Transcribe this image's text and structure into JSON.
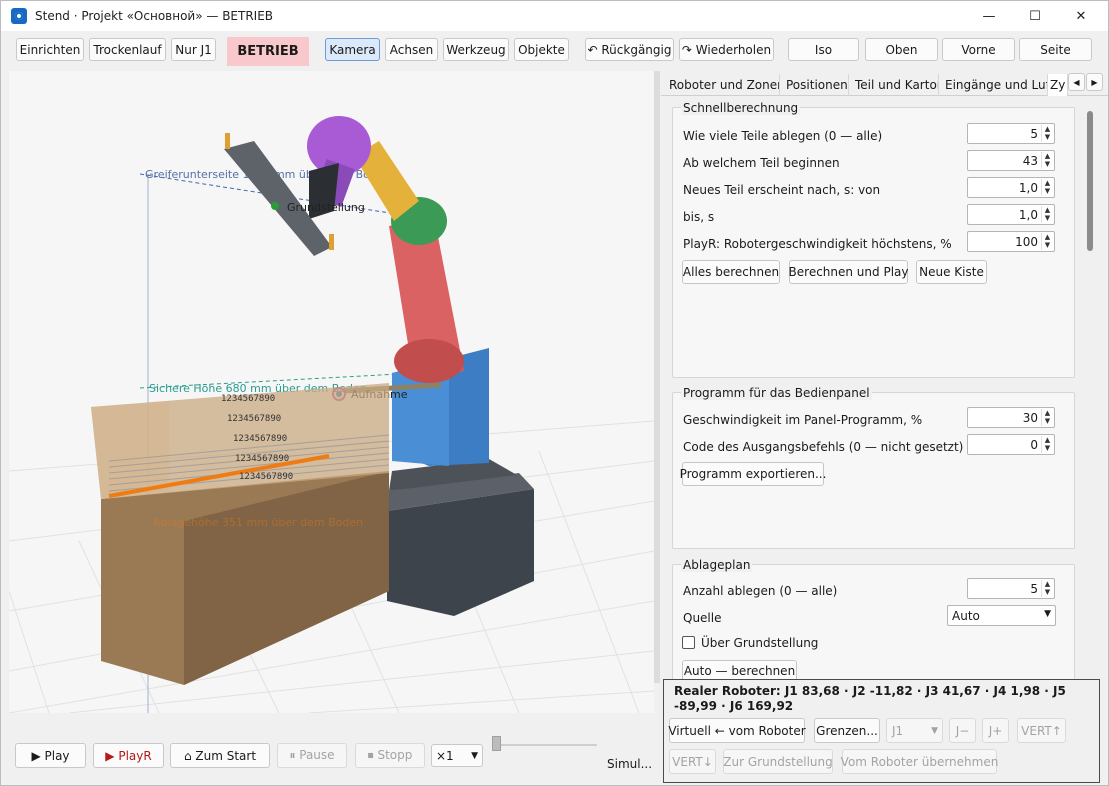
{
  "window": {
    "title": "Stend · Projekt «Основной» — BETRIEB",
    "min": "—",
    "max": "☐",
    "close": "✕"
  },
  "toolbar": {
    "mode_buttons": [
      "Einrichten",
      "Trockenlauf",
      "Nur J1"
    ],
    "mode_badge": "BETRIEB",
    "view_tabs": [
      "Kamera",
      "Achsen",
      "Werkzeug",
      "Objekte"
    ],
    "undo": "↶ Rückgängig",
    "redo": "↷ Wiederholen",
    "camera_views": [
      "Iso",
      "Oben",
      "Vorne",
      "Seite"
    ]
  },
  "viewport": {
    "label_gripper": "Greiferunterseite 1100 mm über dem Boden",
    "label_home": "Grundstellung",
    "label_safe": "Sichere Höhe 680 mm über dem Boden",
    "label_pick": "Aufnahme",
    "label_place": "Ablagehöhe 351 mm über dem Boden"
  },
  "bottom": {
    "play": "▶ Play",
    "playr": "▶ PlayR",
    "start": "⌂ Zum Start",
    "pause": "⏸ Pause",
    "stop": "⏹ Stopp",
    "speed": "×1",
    "sim_status": "Simul..."
  },
  "tabs": [
    "Roboter und Zonen",
    "Positionen",
    "Teil und Karton",
    "Eingänge und Luft",
    "Zy"
  ],
  "quick": {
    "title": "Schnellberechnung",
    "rows": [
      {
        "label": "Wie viele Teile ablegen (0 — alle)",
        "value": "5"
      },
      {
        "label": "Ab welchem Teil beginnen",
        "value": "43"
      },
      {
        "label": "Neues Teil erscheint nach, s: von",
        "value": "1,0"
      },
      {
        "label": "bis, s",
        "value": "1,0"
      },
      {
        "label": "PlayR: Robotergeschwindigkeit höchstens, %",
        "value": "100"
      }
    ],
    "buttons": [
      "Alles berechnen",
      "Berechnen und Play",
      "Neue Kiste"
    ]
  },
  "panel_program": {
    "title": "Programm für das Bedienpanel",
    "rows": [
      {
        "label": "Geschwindigkeit im Panel-Programm, %",
        "value": "30"
      },
      {
        "label": "Code des Ausgangsbefehls (0 — nicht gesetzt)",
        "value": "0"
      }
    ],
    "export": "Programm exportieren..."
  },
  "placement": {
    "title": "Ablageplan",
    "count_label": "Anzahl ablegen (0 — alle)",
    "count_value": "5",
    "source_label": "Quelle",
    "source_value": "Auto",
    "checkbox": "Über Grundstellung",
    "auto_btn": "Auto — berechnen"
  },
  "status": {
    "text": "Realer Roboter: J1 83,68 · J2 -11,82 · J3 41,67 · J4 1,98 · J5 -89,99 · J6 169,92",
    "virt": "Virtuell ← vom Roboter",
    "limits": "Grenzen...",
    "joint": "J1",
    "jminus": "J−",
    "jplus": "J+",
    "vert_up": "VERT↑",
    "vert_down": "VERT↓",
    "to_home": "Zur Grundstellung",
    "from_robot": "Vom Roboter übernehmen"
  }
}
